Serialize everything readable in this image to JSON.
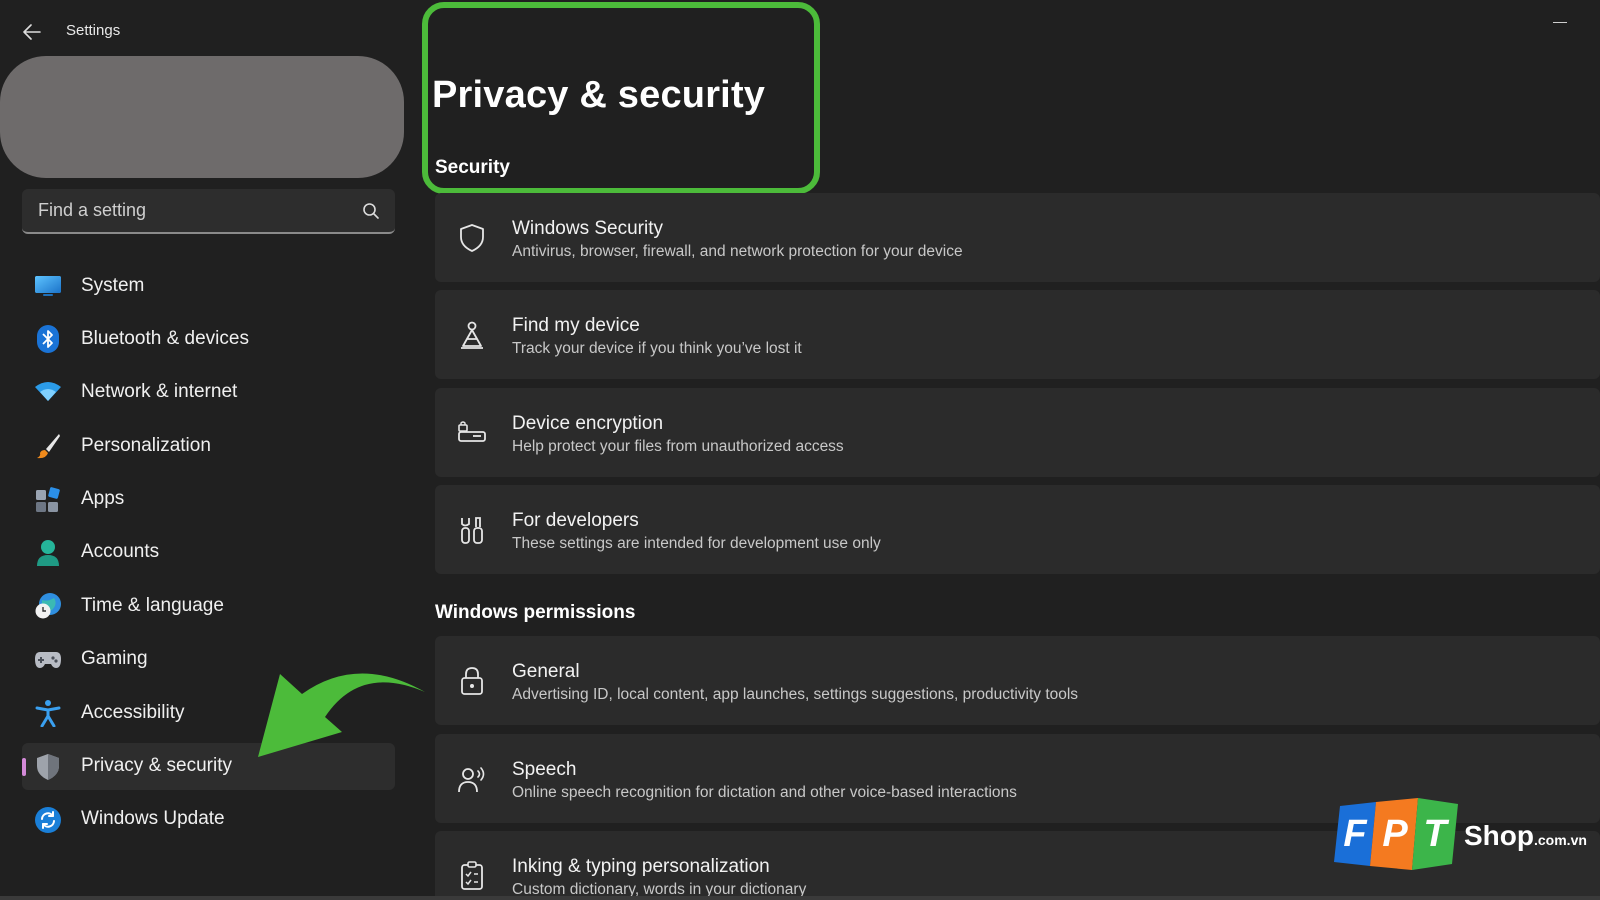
{
  "window": {
    "title": "Settings"
  },
  "search": {
    "placeholder": "Find a setting"
  },
  "sidebar": {
    "items": [
      {
        "label": "System",
        "icon": "monitor-icon"
      },
      {
        "label": "Bluetooth & devices",
        "icon": "bluetooth-icon"
      },
      {
        "label": "Network & internet",
        "icon": "wifi-icon"
      },
      {
        "label": "Personalization",
        "icon": "brush-icon"
      },
      {
        "label": "Apps",
        "icon": "apps-icon"
      },
      {
        "label": "Accounts",
        "icon": "person-icon"
      },
      {
        "label": "Time & language",
        "icon": "globe-clock-icon"
      },
      {
        "label": "Gaming",
        "icon": "gamepad-icon"
      },
      {
        "label": "Accessibility",
        "icon": "accessibility-icon"
      },
      {
        "label": "Privacy & security",
        "icon": "shield-icon",
        "active": true
      },
      {
        "label": "Windows Update",
        "icon": "update-icon"
      }
    ]
  },
  "main": {
    "page_title": "Privacy & security",
    "sections": [
      {
        "title": "Security",
        "cards": [
          {
            "title": "Windows Security",
            "desc": "Antivirus, browser, firewall, and network protection for your device",
            "icon": "shield-outline-icon"
          },
          {
            "title": "Find my device",
            "desc": "Track your device if you think you’ve lost it",
            "icon": "find-device-icon"
          },
          {
            "title": "Device encryption",
            "desc": "Help protect your files from unauthorized access",
            "icon": "encryption-icon"
          },
          {
            "title": "For developers",
            "desc": "These settings are intended for development use only",
            "icon": "developer-tools-icon"
          }
        ]
      },
      {
        "title": "Windows permissions",
        "cards": [
          {
            "title": "General",
            "desc": "Advertising ID, local content, app launches, settings suggestions, productivity tools",
            "icon": "lock-icon"
          },
          {
            "title": "Speech",
            "desc": "Online speech recognition for dictation and other voice-based interactions",
            "icon": "speech-icon"
          },
          {
            "title": "Inking & typing personalization",
            "desc": "Custom dictionary, words in your dictionary",
            "icon": "clipboard-icon"
          }
        ]
      }
    ]
  },
  "annotations": {
    "highlight_color": "#4cbb3a",
    "arrow_color": "#4cbb3a"
  },
  "watermark": {
    "letters": [
      "F",
      "P",
      "T"
    ],
    "brand": "Shop",
    "domain": ".com.vn"
  },
  "colors": {
    "background": "#202020",
    "card": "#2b2b2b",
    "active_indicator": "#d48ad8",
    "accent_blue": "#0a7fd8"
  }
}
